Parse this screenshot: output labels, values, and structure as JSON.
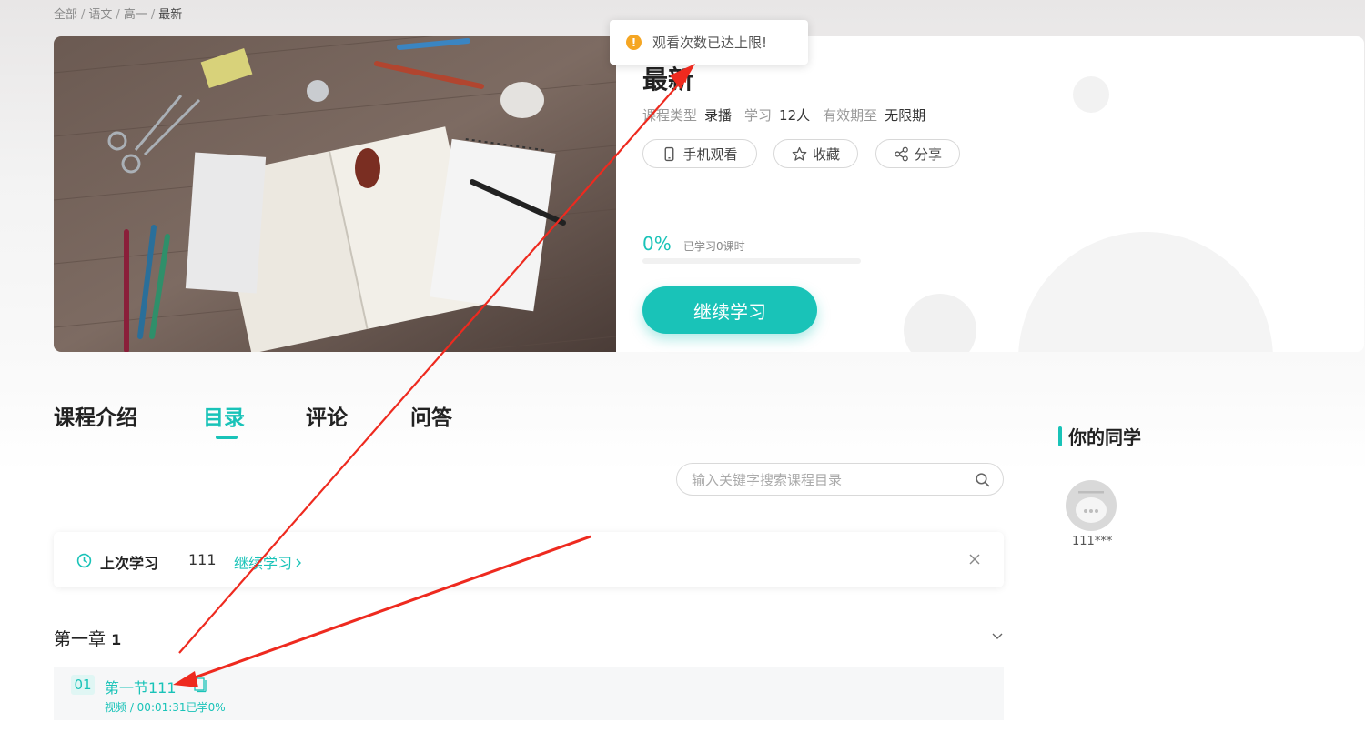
{
  "breadcrumb": {
    "items": [
      "全部",
      "语文",
      "高一"
    ],
    "current": "最新"
  },
  "toast": {
    "text": "观看次数已达上限!"
  },
  "course": {
    "title": "最新",
    "meta": [
      {
        "label": "课程类型",
        "value": "录播"
      },
      {
        "label": "学习",
        "value": "12人"
      },
      {
        "label": "有效期至",
        "value": "无限期"
      }
    ],
    "actions": {
      "mobile": "手机观看",
      "favorite": "收藏",
      "share": "分享"
    },
    "progress_text": "0%",
    "progress_value": 0,
    "learned_text": "已学习0课时",
    "continue_button": "继续学习"
  },
  "tabs": [
    {
      "label": "课程介绍",
      "active": false
    },
    {
      "label": "目录",
      "active": true
    },
    {
      "label": "评论",
      "active": false
    },
    {
      "label": "问答",
      "active": false
    }
  ],
  "search": {
    "placeholder": "输入关键字搜索课程目录"
  },
  "last_study": {
    "label": "上次学习",
    "lesson": "111",
    "link": "继续学习"
  },
  "chapter": {
    "prefix": "第一章",
    "number": "1"
  },
  "lesson": {
    "index": "01",
    "name": "第一节111",
    "sub": "视频 / 00:01:31已学0%"
  },
  "classmates": {
    "heading": "你的同学",
    "users": [
      {
        "name": "111***"
      }
    ]
  },
  "colors": {
    "accent": "#19c3b8",
    "warn": "#f5a623",
    "annotation": "#ee2a1f"
  },
  "icons": [
    "phone-icon",
    "star-icon",
    "share-icon",
    "search-icon",
    "clock-icon",
    "close-icon",
    "chevron-down-icon",
    "document-icon",
    "warning-icon"
  ]
}
